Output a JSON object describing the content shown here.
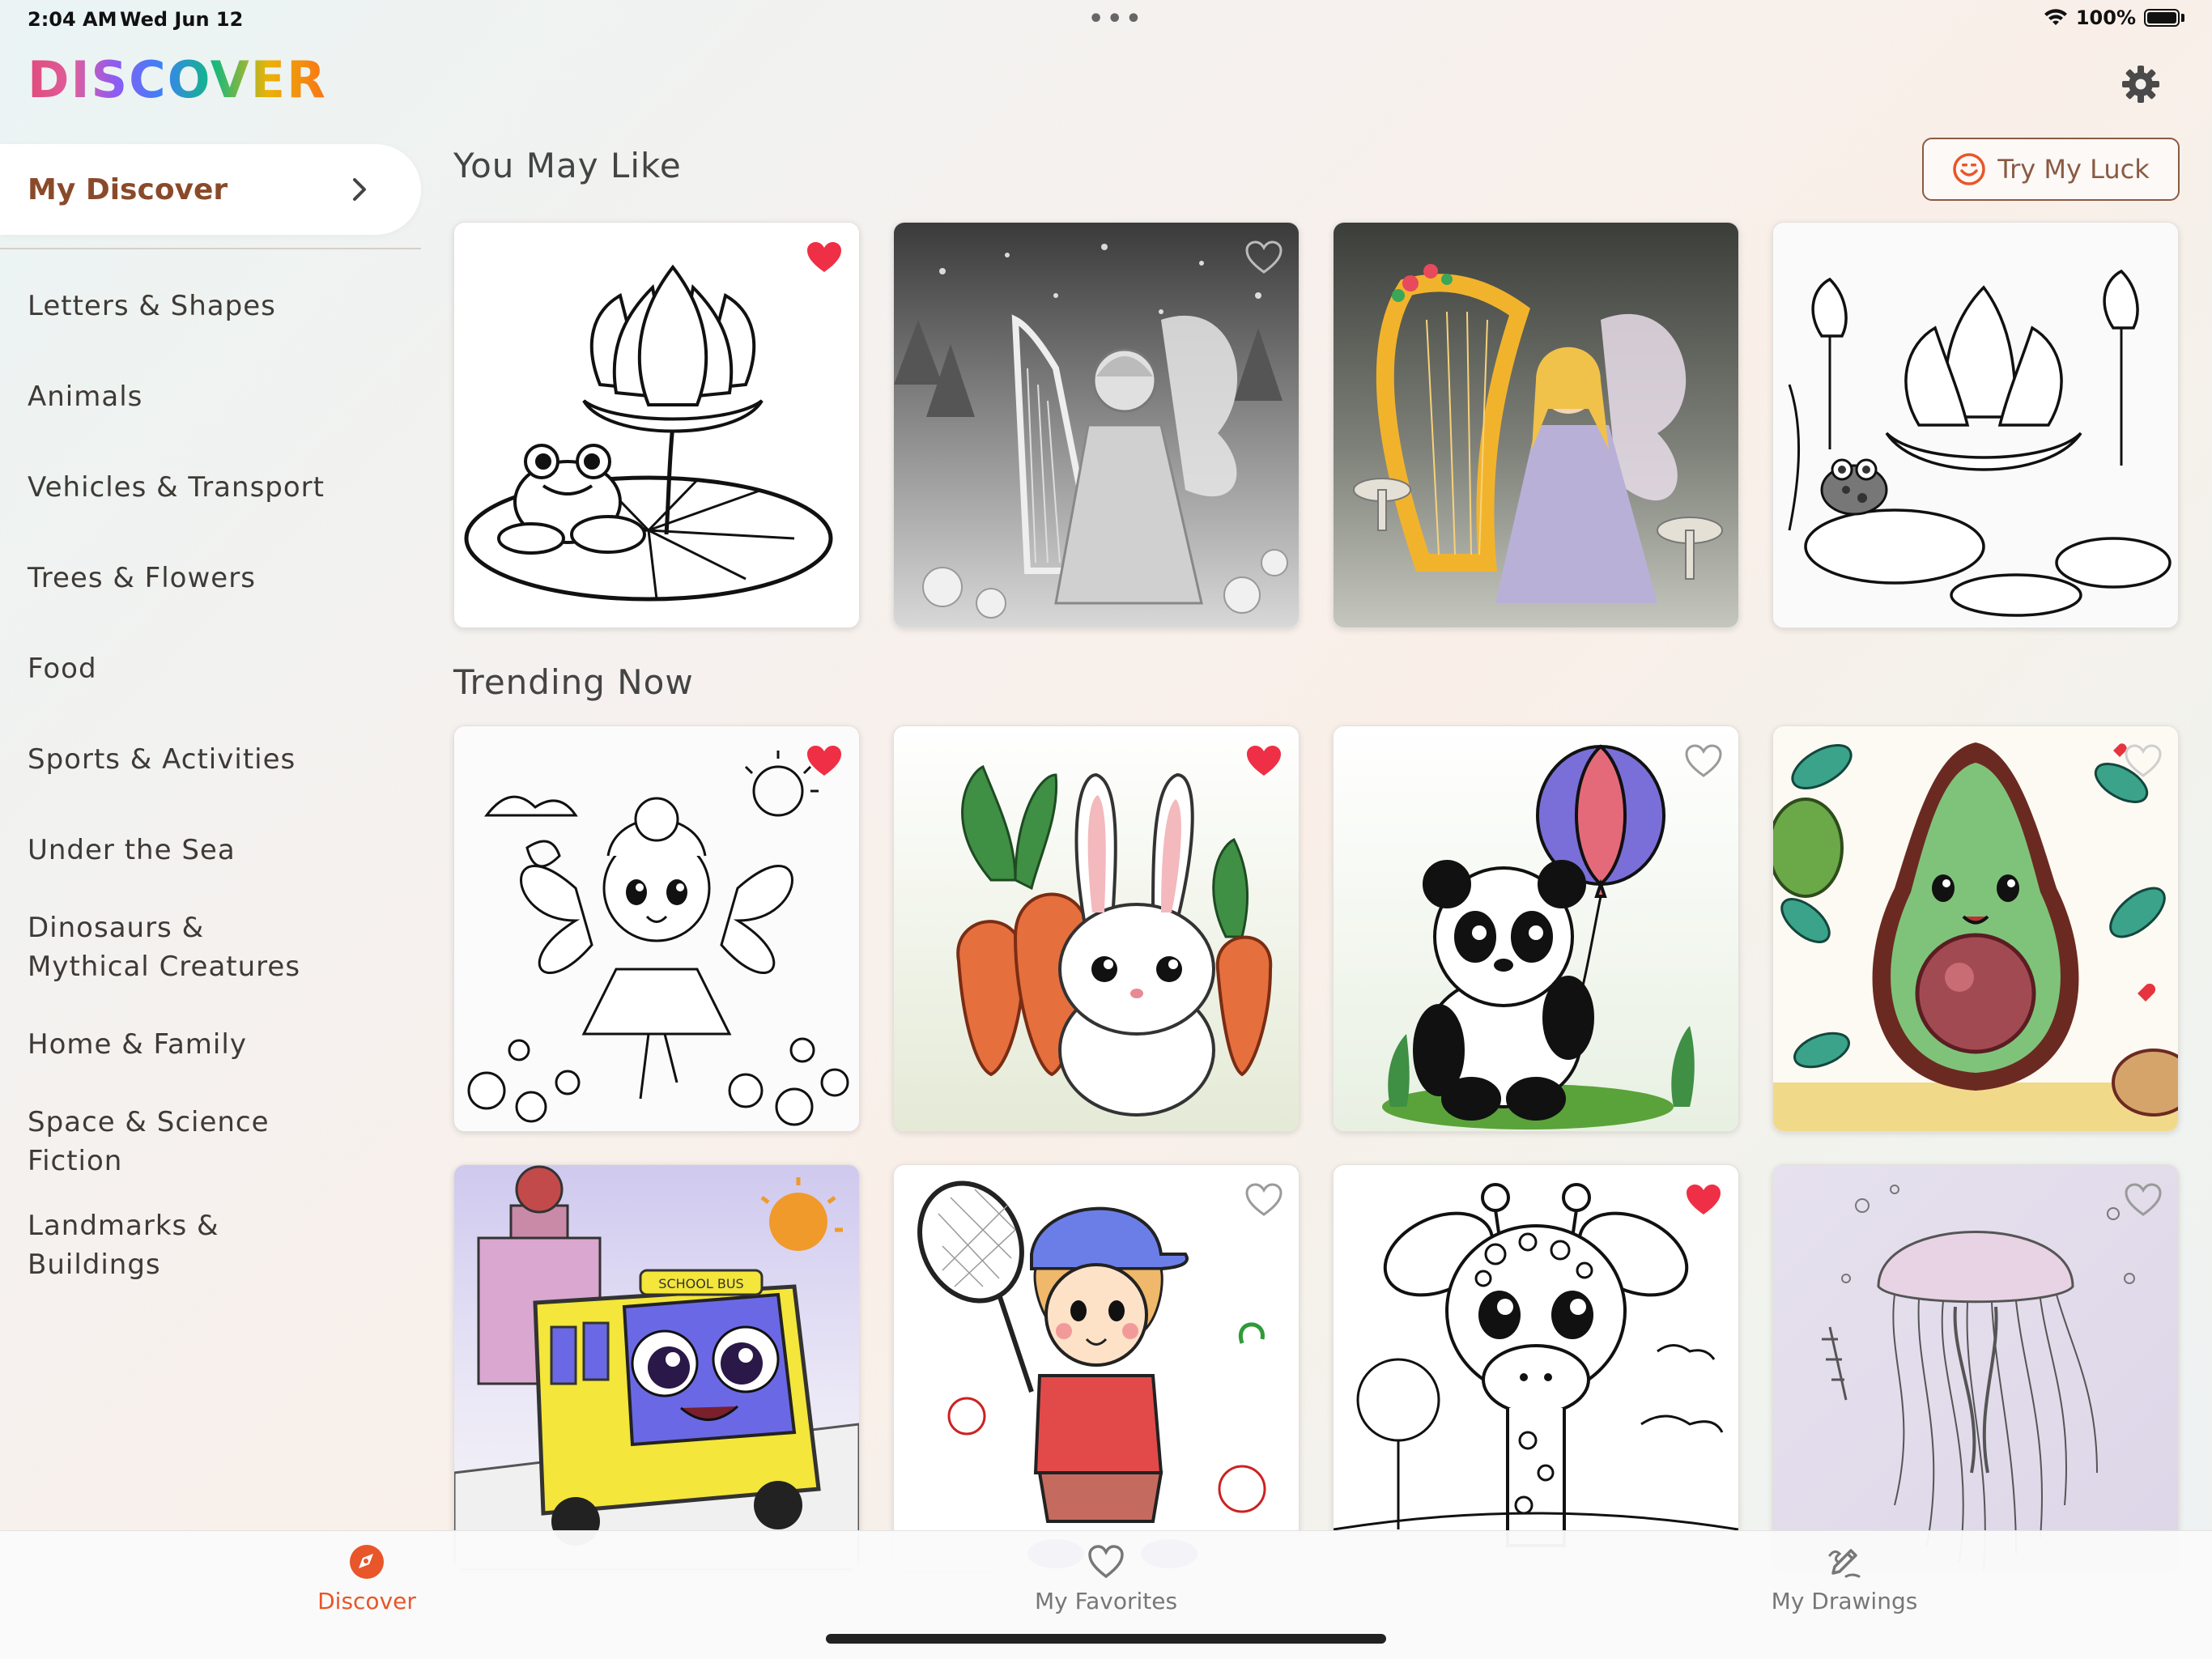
{
  "status": {
    "time": "2:04 AM",
    "date": "Wed Jun 12",
    "battery": "100%"
  },
  "app": {
    "title": "DISCOVER"
  },
  "sidebar": {
    "selected": "My Discover",
    "items": [
      {
        "label": "Letters & Shapes"
      },
      {
        "label": "Animals"
      },
      {
        "label": "Vehicles & Transport"
      },
      {
        "label": "Trees & Flowers"
      },
      {
        "label": "Food"
      },
      {
        "label": "Sports & Activities"
      },
      {
        "label": "Under the Sea"
      },
      {
        "label": "Dinosaurs & Mythical Creatures"
      },
      {
        "label": "Home & Family"
      },
      {
        "label": "Space & Science Fiction"
      },
      {
        "label": "Landmarks & Buildings"
      }
    ]
  },
  "sections": {
    "you_may_like": {
      "title": "You May Like"
    },
    "trending": {
      "title": "Trending Now"
    }
  },
  "try_luck": {
    "label": "Try My Luck"
  },
  "cards": {
    "you_may_like": [
      {
        "subject": "frog on lily pad with lotus",
        "favorited": true
      },
      {
        "subject": "fairy playing harp",
        "favorited": false
      },
      {
        "subject": "fairy with golden harp colored",
        "favorited": false
      },
      {
        "subject": "lotus garden with frog",
        "favorited": false
      }
    ],
    "trending": [
      {
        "subject": "flower fairy dancing",
        "favorited": true
      },
      {
        "subject": "bunny with carrots",
        "favorited": true
      },
      {
        "subject": "panda with balloon",
        "favorited": false
      },
      {
        "subject": "happy avocado",
        "favorited": false
      },
      {
        "subject": "school bus",
        "favorited": false
      },
      {
        "subject": "boy with tennis racket",
        "favorited": false
      },
      {
        "subject": "baby giraffe",
        "favorited": true
      },
      {
        "subject": "jellyfish",
        "favorited": false
      }
    ]
  },
  "tabbar": {
    "discover": "Discover",
    "favorites": "My Favorites",
    "drawings": "My Drawings"
  },
  "colors": {
    "accent": "#e8562a",
    "heart_active": "#ef2f45",
    "heart_inactive": "#9a9a9a",
    "selected_text": "#8a4a2a"
  }
}
